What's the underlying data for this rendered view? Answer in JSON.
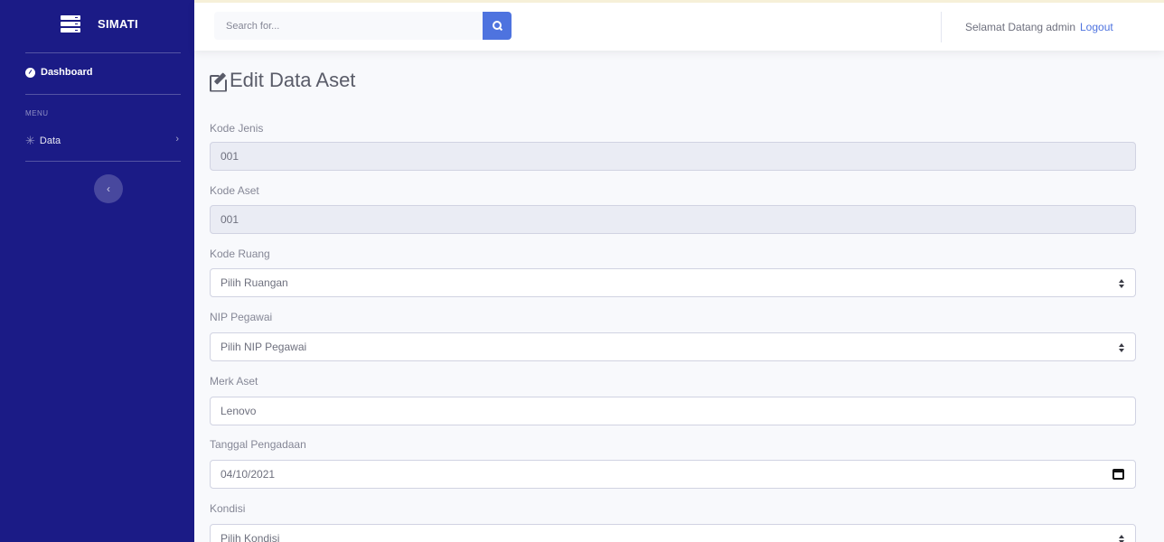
{
  "brand": {
    "name": "SIMATI",
    "icon": "server-icon"
  },
  "sidebar": {
    "dashboard_label": "Dashboard",
    "menu_heading": "MENU",
    "data_label": "Data",
    "toggle_symbol": "‹"
  },
  "topbar": {
    "search_placeholder": "Search for...",
    "welcome_text": "Selamat Datang admin",
    "logout_label": "Logout"
  },
  "page": {
    "title": "Edit Data Aset"
  },
  "form": {
    "kode_jenis": {
      "label": "Kode Jenis",
      "value": "001"
    },
    "kode_aset": {
      "label": "Kode Aset",
      "value": "001"
    },
    "kode_ruang": {
      "label": "Kode Ruang",
      "value": "Pilih Ruangan"
    },
    "nip_pegawai": {
      "label": "NIP Pegawai",
      "value": "Pilih NIP Pegawai"
    },
    "merk_aset": {
      "label": "Merk Aset",
      "value": "Lenovo"
    },
    "tanggal_pengadaan": {
      "label": "Tanggal Pengadaan",
      "value": "04/10/2021"
    },
    "kondisi": {
      "label": "Kondisi",
      "value": "Pilih Kondisi"
    }
  },
  "colors": {
    "sidebar": "#1b1b86",
    "primary": "#4e73df",
    "readonly_bg": "#eaecf4"
  }
}
